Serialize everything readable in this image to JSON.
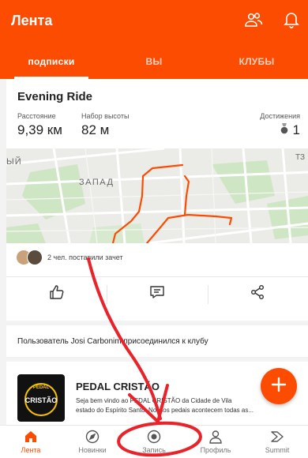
{
  "header": {
    "title": "Лента",
    "icons": [
      "people-icon",
      "bell-icon"
    ],
    "background": "#fc4c02"
  },
  "tabs": [
    {
      "label": "подписки",
      "active": true
    },
    {
      "label": "вы",
      "active": false
    },
    {
      "label": "клубы",
      "active": false
    }
  ],
  "activity": {
    "title": "Evening Ride",
    "stats": [
      {
        "label": "Расстояние",
        "value": "9,39 км"
      },
      {
        "label": "Набор высоты",
        "value": "82 м"
      }
    ],
    "achievements": {
      "label": "Достижения",
      "value": "1"
    },
    "map": {
      "labels": [
        "ЫЙ",
        "ЗАПАД",
        "ТЗ"
      ],
      "route_color": "#fc4c02"
    },
    "kudos_text": "2 чел. поставили зачет",
    "action_icons": [
      "thumbs-up-icon",
      "comment-icon",
      "share-icon"
    ]
  },
  "club_notice": {
    "text": "Пользователь Josi Carbonim присоединился к клубу"
  },
  "club": {
    "name": "PEDAL CRISTÃO",
    "logo_text": "CRISTÃO",
    "logo_top_text": "PEDAL",
    "description_lines": [
      "Seja bem vindo ao PEDAL CRISTÃO da Cidade de Vila",
      "estado do Espírito Santo. Nossos pedais acontecem todas as..."
    ]
  },
  "fab": {
    "icon": "plus-icon"
  },
  "bottom_nav": [
    {
      "label": "Лента",
      "icon": "home-icon",
      "active": true
    },
    {
      "label": "Новинки",
      "icon": "compass-icon",
      "active": false
    },
    {
      "label": "Запись",
      "icon": "record-icon",
      "active": false
    },
    {
      "label": "Профиль",
      "icon": "profile-icon",
      "active": false
    },
    {
      "label": "Summit",
      "icon": "summit-icon",
      "active": false
    }
  ],
  "colors": {
    "accent": "#fc4c02",
    "annotation": "#e8232a"
  }
}
